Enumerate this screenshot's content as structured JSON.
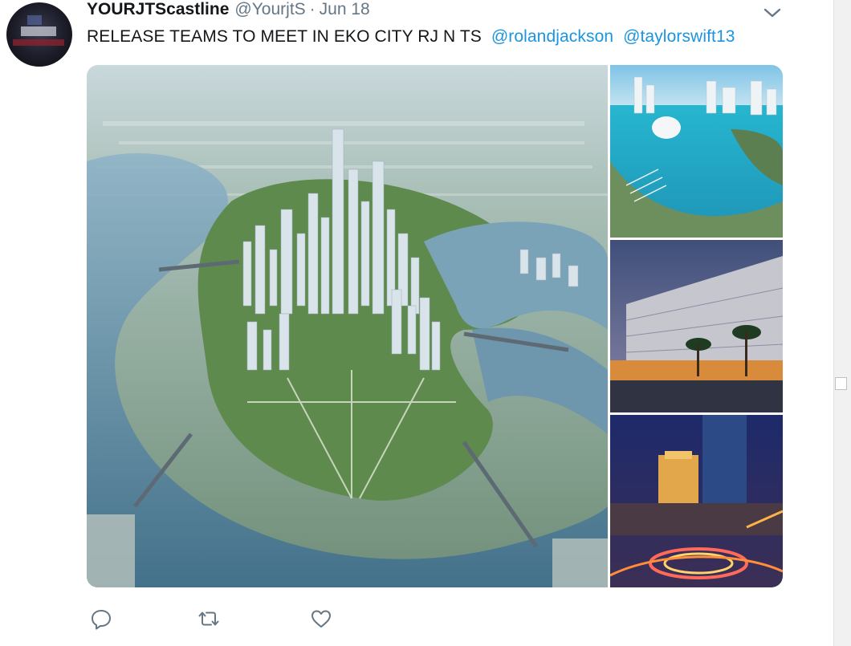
{
  "tweet": {
    "display_name": "YOURJTScastline",
    "handle": "@YourjtS",
    "separator": "·",
    "date": "Jun 18",
    "text": "RELEASE TEAMS TO MEET IN EKO CITY RJ N TS",
    "mentions": [
      "@rolandjackson",
      "@taylorswift13"
    ]
  },
  "media": {
    "images": [
      {
        "name": "city-aerial-rendering"
      },
      {
        "name": "marina-waterfront"
      },
      {
        "name": "hotel-facade-dusk"
      },
      {
        "name": "city-night-roundabout"
      }
    ]
  },
  "icons": {
    "menu": "chevron-down-icon",
    "reply": "reply-icon",
    "retweet": "retweet-icon",
    "like": "heart-icon"
  },
  "colors": {
    "link": "#1b95e0",
    "secondary_text": "#657786",
    "primary_text": "#14171a",
    "icon": "#657786"
  }
}
